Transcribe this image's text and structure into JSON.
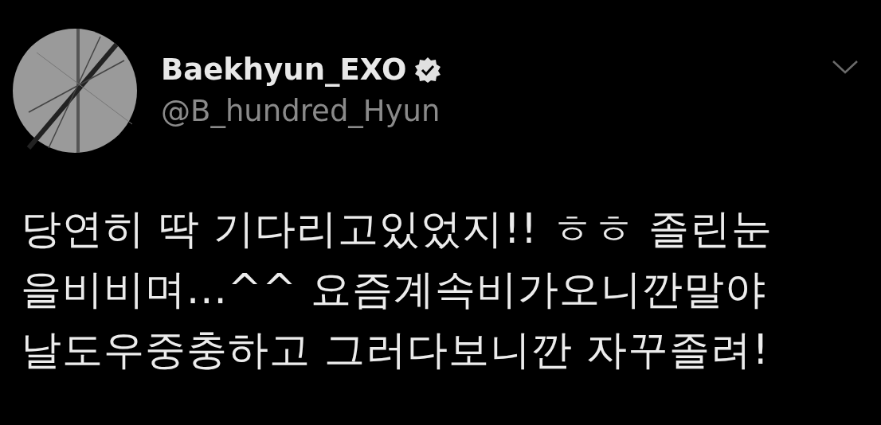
{
  "tweet": {
    "display_name": "Baekhyun_EXO",
    "verified": true,
    "handle": "@B_hundred_Hyun",
    "text_lines": [
      "당연히 딱 기다리고있었지!! ㅎㅎ 졸린눈",
      "을비비며...^^ 요즘계속비가오니깐말야",
      "날도우중충하고 그러다보니깐 자꾸졸려!"
    ]
  }
}
